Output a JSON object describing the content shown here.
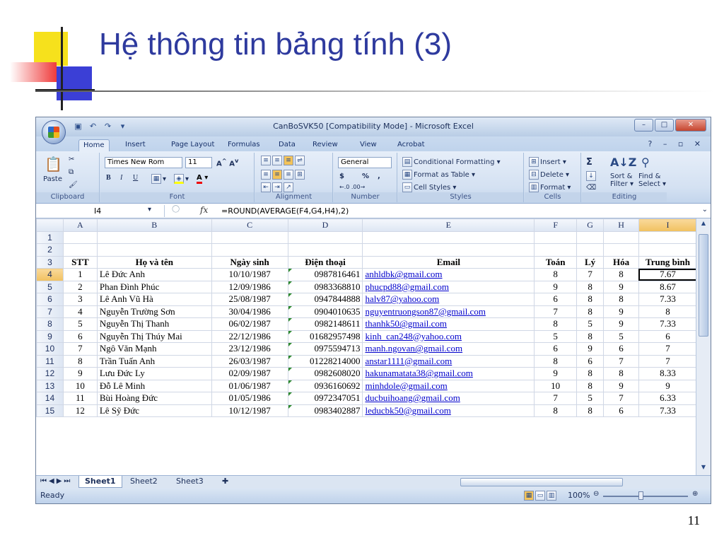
{
  "slide": {
    "title": "Hệ thông tin bảng tính (3)",
    "page_number": "11"
  },
  "excel": {
    "window_title": "CanBoSVK50  [Compatibility Mode] - Microsoft Excel",
    "tabs": [
      "Home",
      "Insert",
      "Page Layout",
      "Formulas",
      "Data",
      "Review",
      "View",
      "Acrobat"
    ],
    "active_tab": "Home",
    "ribbon": {
      "clipboard": {
        "paste": "Paste",
        "label": "Clipboard"
      },
      "font": {
        "name": "Times New Rom",
        "size": "11",
        "label": "Font",
        "bold": "B",
        "italic": "I",
        "underline": "U"
      },
      "alignment": {
        "label": "Alignment"
      },
      "number": {
        "format": "General",
        "currency": "$",
        "percent": "%",
        "comma": ",",
        "label": "Number"
      },
      "styles": {
        "conditional": "Conditional Formatting",
        "format_table": "Format as Table",
        "cell_styles": "Cell Styles",
        "label": "Styles"
      },
      "cells": {
        "insert": "Insert",
        "delete": "Delete",
        "format": "Format",
        "label": "Cells"
      },
      "editing": {
        "sum": "Σ",
        "sort": "Sort &",
        "filter": "Filter",
        "find": "Find &",
        "select": "Select",
        "label": "Editing"
      }
    },
    "name_box": "I4",
    "fx": "fx",
    "formula": "=ROUND(AVERAGE(F4,G4,H4),2)",
    "columns": [
      "A",
      "B",
      "C",
      "D",
      "E",
      "F",
      "G",
      "H",
      "I"
    ],
    "header_row": [
      "STT",
      "Họ và tên",
      "Ngày sinh",
      "Điện thoại",
      "Email",
      "Toán",
      "Lý",
      "Hóa",
      "Trung bình"
    ],
    "rows": [
      [
        "1",
        "Lê Đức Anh",
        "10/10/1987",
        "0987816461",
        "anhldbk@gmail.com",
        "8",
        "7",
        "8",
        "7.67"
      ],
      [
        "2",
        "Phan Đình Phúc",
        "12/09/1986",
        "0983368810",
        "phucpd88@gmail.com",
        "9",
        "8",
        "9",
        "8.67"
      ],
      [
        "3",
        "Lê Anh Vũ Hà",
        "25/08/1987",
        "0947844888",
        "halv87@yahoo.com",
        "6",
        "8",
        "8",
        "7.33"
      ],
      [
        "4",
        "Nguyễn Trường Sơn",
        "30/04/1986",
        "0904010635",
        "nguyentruongson87@gmail.com",
        "7",
        "8",
        "9",
        "8"
      ],
      [
        "5",
        "Nguyễn Thị Thanh",
        "06/02/1987",
        "0982148611",
        "thanhk50@gmail.com",
        "8",
        "5",
        "9",
        "7.33"
      ],
      [
        "6",
        "Nguyễn Thị Thúy Mai",
        "22/12/1986",
        "01682957498",
        "kinh_can248@yahoo.com",
        "5",
        "8",
        "5",
        "6"
      ],
      [
        "7",
        "Ngô Văn Mạnh",
        "23/12/1986",
        "0975594713",
        "manh.ngovan@gmail.com",
        "6",
        "9",
        "6",
        "7"
      ],
      [
        "8",
        "Trần Tuấn Anh",
        "26/03/1987",
        "01228214000",
        "anstar1111@gmail.com",
        "8",
        "6",
        "7",
        "7"
      ],
      [
        "9",
        "Lưu Đức Ly",
        "02/09/1987",
        "0982608020",
        "hakunamatata38@gmail.com",
        "9",
        "8",
        "8",
        "8.33"
      ],
      [
        "10",
        "Đỗ Lê Minh",
        "01/06/1987",
        "0936160692",
        "minhdole@gmail.com",
        "10",
        "8",
        "9",
        "9"
      ],
      [
        "11",
        "Bùi Hoàng Đức",
        "01/05/1986",
        "0972347051",
        "ducbuihoang@gmail.com",
        "7",
        "5",
        "7",
        "6.33"
      ],
      [
        "12",
        "Lê Sỹ Đức",
        "10/12/1987",
        "0983402887",
        "leducbk50@gmail.com",
        "8",
        "8",
        "6",
        "7.33"
      ]
    ],
    "sheets": [
      "Sheet1",
      "Sheet2",
      "Sheet3"
    ],
    "active_sheet": "Sheet1",
    "status": "Ready",
    "zoom": "100%"
  }
}
